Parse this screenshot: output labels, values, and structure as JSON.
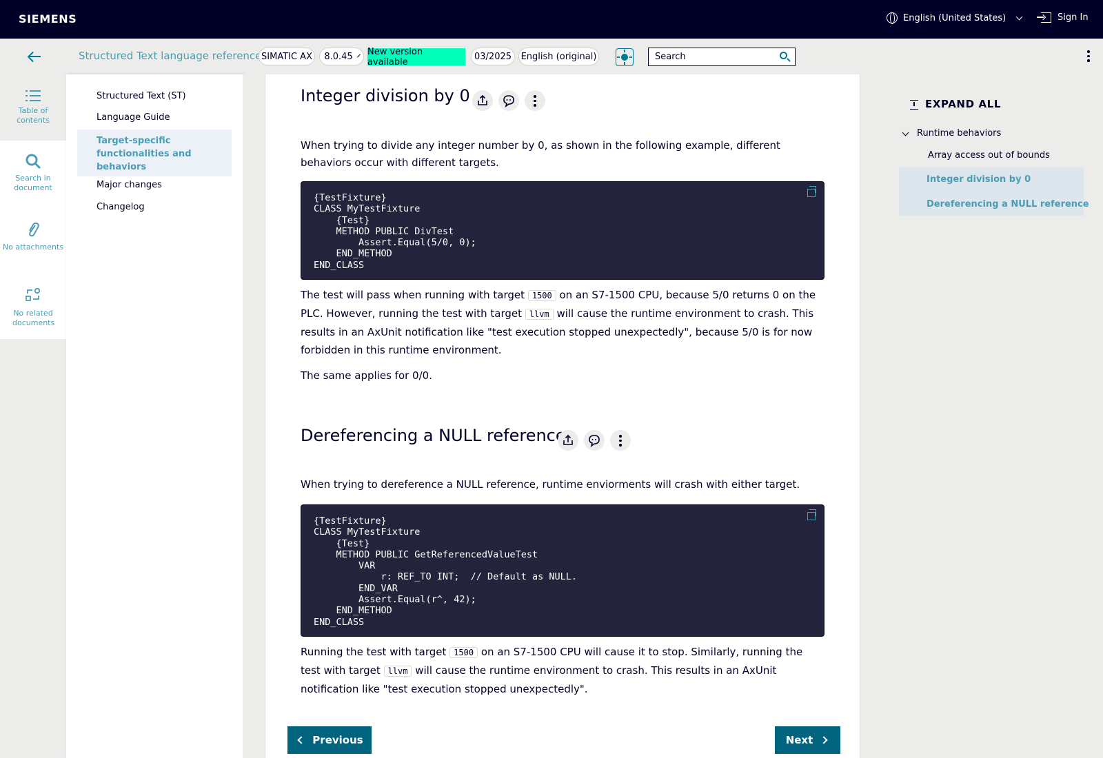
{
  "header": {
    "brand": "SIEMENS",
    "language": "English (United States)",
    "sign_in": "Sign In"
  },
  "subbar": {
    "doc_title": "Structured Text language reference",
    "product": "SIMATIC AX",
    "version": "8.0.45",
    "new_version": "New version available",
    "date": "03/2025",
    "doc_language": "English (original)",
    "search_placeholder": "Search"
  },
  "rail": {
    "toc": "Table of contents",
    "search": "Search in document",
    "attachments": "No attachments",
    "related": "No related documents"
  },
  "toc": {
    "items": [
      "Structured Text (ST)",
      "Language Guide",
      "Target-specific functionalities and behaviors",
      "Major changes",
      "Changelog"
    ]
  },
  "content": {
    "section1": {
      "title": "Integer division by 0",
      "intro": "When trying to divide any integer number by 0, as shown in the following example, different behaviors occur with different targets.",
      "code": "{TestFixture}\nCLASS MyTestFixture\n    {Test}\n    METHOD PUBLIC DivTest\n        Assert.Equal(5/0, 0);\n    END_METHOD\nEND_CLASS",
      "p1_a": "The test will pass when running with target",
      "p1_code1": "1500",
      "p1_b": "on an S7-1500 CPU, because 5/0 returns 0 on the PLC. However, running the test with target",
      "p1_code2": "llvm",
      "p1_c": "will cause the runtime environment to crash. This results in an AxUnit notification like \"test execution stopped unexpectedly\", because 5/0 is for now forbidden in this runtime environment.",
      "p2": "The same applies for 0/0."
    },
    "section2": {
      "title": "Dereferencing a NULL reference",
      "intro": "When trying to dereference a NULL reference, runtime enviorments will crash with either target.",
      "code": "{TestFixture}\nCLASS MyTestFixture\n    {Test}\n    METHOD PUBLIC GetReferencedValueTest\n        VAR\n            r: REF_TO INT;  // Default as NULL.\n        END_VAR\n        Assert.Equal(r^, 42);\n    END_METHOD\nEND_CLASS",
      "p1_a": "Running the test with target",
      "p1_code1": "1500",
      "p1_b": "on an S7-1500 CPU will cause it to stop. Similarly, running the test with target",
      "p1_code2": "llvm",
      "p1_c": "will cause the runtime environment to crash. This results in an AxUnit notification like \"test execution stopped unexpectedly\"."
    },
    "prev_label": "Previous",
    "next_label": "Next"
  },
  "outline": {
    "expand_all": "EXPAND ALL",
    "parent": "Runtime behaviors",
    "items": [
      "Array access out of bounds",
      "Integer division by 0",
      "Dereferencing a NULL reference"
    ]
  },
  "colors": {
    "header_bg": "#000028",
    "accent": "#007993",
    "accent_text": "#4a9db4",
    "new_version_bg": "#00ffb9",
    "code_bg": "#23233c",
    "button_bg": "#00647e",
    "panel_bg": "#ececeb"
  }
}
